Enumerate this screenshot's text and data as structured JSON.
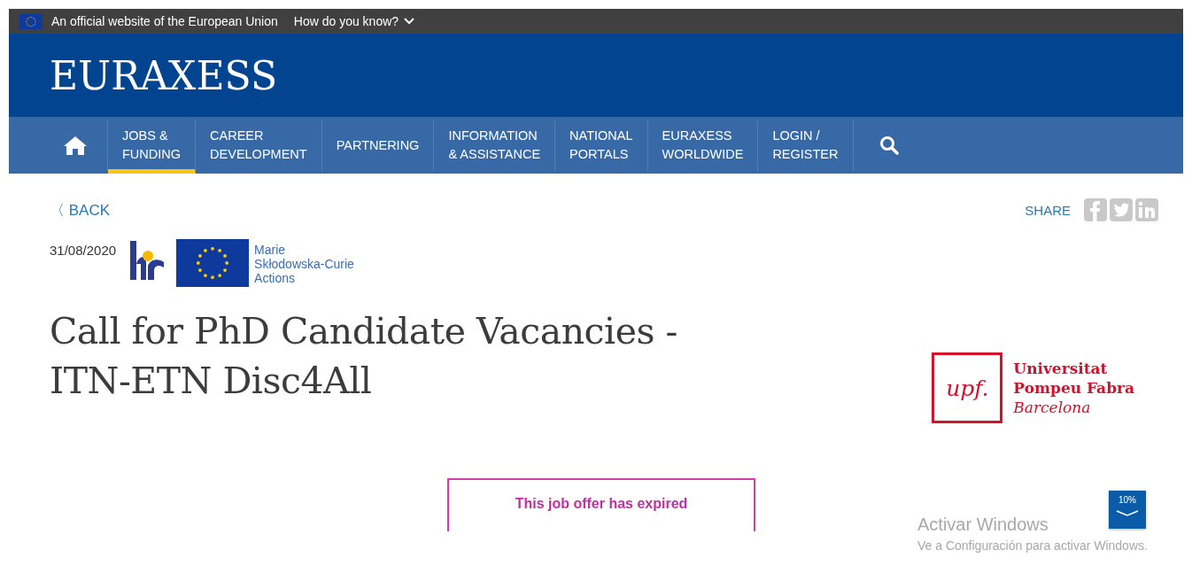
{
  "eu_bar": {
    "text": "An official website of the European Union",
    "link": "How do you know?"
  },
  "site": {
    "logo": "EURAXESS"
  },
  "nav": {
    "items": [
      {
        "kind": "home",
        "selected": false
      },
      {
        "kind": "link",
        "lines": [
          "JOBS &",
          "FUNDING"
        ],
        "selected": true
      },
      {
        "kind": "link",
        "lines": [
          "CAREER",
          "DEVELOPMENT"
        ],
        "selected": false
      },
      {
        "kind": "link",
        "lines": [
          "PARTNERING"
        ],
        "selected": false
      },
      {
        "kind": "link",
        "lines": [
          "INFORMATION",
          "& ASSISTANCE"
        ],
        "selected": false
      },
      {
        "kind": "link",
        "lines": [
          "NATIONAL",
          "PORTALS"
        ],
        "selected": false
      },
      {
        "kind": "link",
        "lines": [
          "EURAXESS",
          "WORLDWIDE"
        ],
        "selected": false
      },
      {
        "kind": "link",
        "lines": [
          "LOGIN /",
          "REGISTER"
        ],
        "selected": false
      },
      {
        "kind": "search",
        "selected": false
      }
    ]
  },
  "back": {
    "icon": "〈",
    "label": "BACK"
  },
  "share": {
    "label": "SHARE"
  },
  "date": "31/08/2020",
  "msca": [
    "Marie",
    "Skłodowska-Curie",
    "Actions"
  ],
  "title": [
    "Call for PhD Candidate Vacancies -",
    "ITN-ETN Disc4All"
  ],
  "university": {
    "mark": "upf.",
    "lines": [
      "Universitat",
      "Pompeu Fabra",
      "Barcelona"
    ]
  },
  "notice": "This job offer has expired",
  "scroll_badge": "10%",
  "os_overlay": {
    "title": "Activar Windows",
    "text": "Ve a Configuración para activar Windows."
  }
}
